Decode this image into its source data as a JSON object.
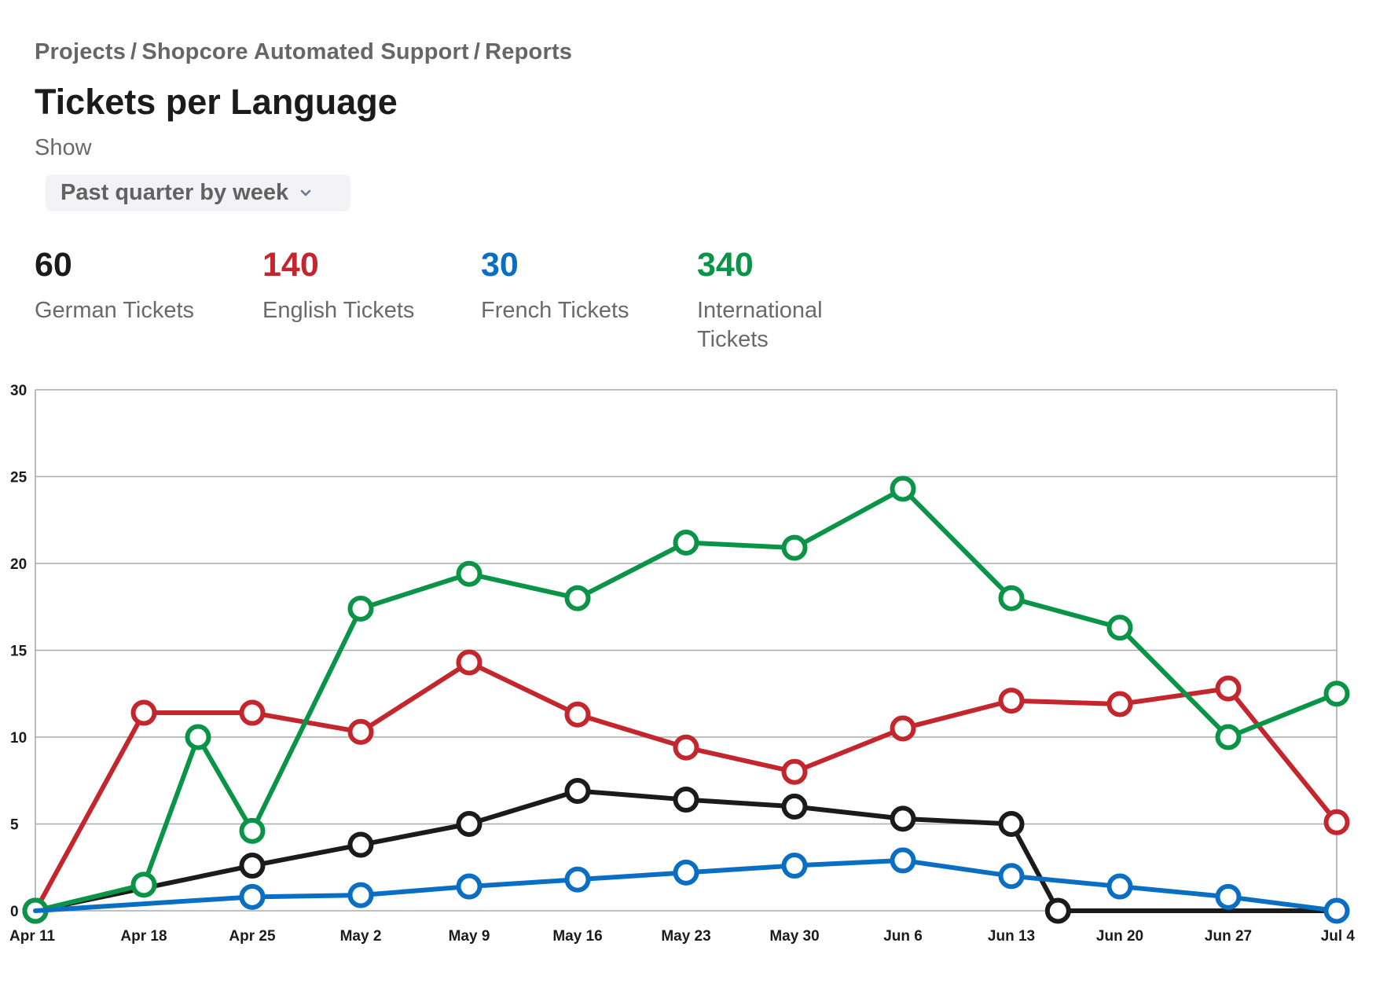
{
  "breadcrumb": [
    "Projects",
    "Shopcore Automated Support",
    "Reports"
  ],
  "breadcrumb_separator": "/",
  "title": "Tickets per Language",
  "filter": {
    "label": "Show",
    "selected": "Past quarter by week",
    "icon": "chevron-down-icon"
  },
  "stats": [
    {
      "value": "60",
      "label": "German Tickets",
      "color": "#1b1b1b"
    },
    {
      "value": "140",
      "label": "English Tickets",
      "color": "#c4262e"
    },
    {
      "value": "30",
      "label": "French Tickets",
      "color": "#0a6fc2"
    },
    {
      "value": "340",
      "label": "International Tickets",
      "color": "#0a9447"
    }
  ],
  "chart_data": {
    "type": "line",
    "title": "",
    "xlabel": "",
    "ylabel": "",
    "categories": [
      "Apr 11",
      "Apr 18",
      "Apr 25",
      "May 2",
      "May 9",
      "May 16",
      "May 23",
      "May 30",
      "Jun 6",
      "Jun 13",
      "Jun 20",
      "Jun 27",
      "Jul 4"
    ],
    "x_note": "x values are week indices into categories; fractional values fall between weekly ticks",
    "ylim": [
      0,
      30
    ],
    "yticks": [
      0,
      5,
      10,
      15,
      20,
      25,
      30
    ],
    "grid": true,
    "legend": "none (series totals shown above chart)",
    "marker": "hollow-circle",
    "series": [
      {
        "name": "German Tickets",
        "color": "#1b1b1b",
        "x": [
          0,
          2,
          3,
          4,
          5,
          6,
          7,
          8,
          9,
          9.43,
          12
        ],
        "values": [
          0,
          2.6,
          3.8,
          5.0,
          6.9,
          6.4,
          6.0,
          5.3,
          5.0,
          0,
          0
        ],
        "markers": [
          true,
          true,
          true,
          true,
          true,
          true,
          true,
          true,
          true,
          true,
          false
        ]
      },
      {
        "name": "English Tickets",
        "color": "#c4262e",
        "x": [
          0,
          1,
          2,
          3,
          4,
          5,
          6,
          7,
          8,
          9,
          10,
          11,
          12
        ],
        "values": [
          0,
          11.4,
          11.4,
          10.3,
          14.3,
          11.3,
          9.4,
          8.0,
          10.5,
          12.1,
          11.9,
          12.8,
          5.1
        ],
        "markers": [
          true,
          true,
          true,
          true,
          true,
          true,
          true,
          true,
          true,
          true,
          true,
          true,
          true
        ]
      },
      {
        "name": "International Tickets",
        "color": "#0a9447",
        "x": [
          0,
          1,
          1.5,
          2,
          3,
          4,
          5,
          6,
          7,
          8,
          9,
          10,
          11,
          12
        ],
        "values": [
          0,
          1.5,
          10.0,
          4.6,
          17.4,
          19.4,
          18.0,
          21.2,
          20.9,
          24.3,
          18.0,
          16.3,
          10.0,
          12.5
        ],
        "markers": [
          true,
          true,
          true,
          true,
          true,
          true,
          true,
          true,
          true,
          true,
          true,
          true,
          true,
          true
        ]
      },
      {
        "name": "French Tickets",
        "color": "#0a6fc2",
        "x": [
          0,
          2,
          3,
          4,
          5,
          6,
          7,
          8,
          9,
          10,
          11,
          12
        ],
        "values": [
          0,
          0.8,
          0.9,
          1.4,
          1.8,
          2.2,
          2.6,
          2.9,
          2.0,
          1.4,
          0.8,
          0
        ],
        "markers": [
          false,
          true,
          true,
          true,
          true,
          true,
          true,
          true,
          true,
          true,
          true,
          true
        ]
      }
    ]
  }
}
